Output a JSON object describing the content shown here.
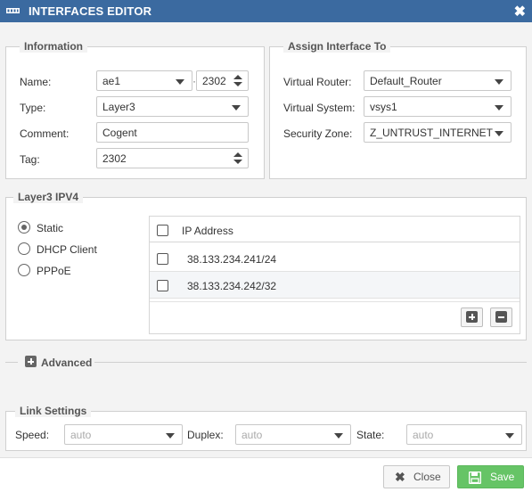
{
  "window": {
    "title": "INTERFACES EDITOR",
    "close_glyph": "✖"
  },
  "information": {
    "legend": "Information",
    "name_label": "Name:",
    "name_value": "ae1",
    "subinterface_value": "2302",
    "type_label": "Type:",
    "type_value": "Layer3",
    "comment_label": "Comment:",
    "comment_value": "Cogent",
    "tag_label": "Tag:",
    "tag_value": "2302"
  },
  "assign": {
    "legend": "Assign Interface To",
    "router_label": "Virtual Router:",
    "router_value": "Default_Router",
    "system_label": "Virtual System:",
    "system_value": "vsys1",
    "zone_label": "Security Zone:",
    "zone_value": "Z_UNTRUST_INTERNET"
  },
  "ipv4": {
    "legend": "Layer3 IPV4",
    "modes": [
      {
        "label": "Static",
        "checked": true
      },
      {
        "label": "DHCP Client",
        "checked": false
      },
      {
        "label": "PPPoE",
        "checked": false
      }
    ],
    "column_header": "IP Address",
    "addresses": [
      "38.133.234.241/24",
      "38.133.234.242/32"
    ]
  },
  "advanced": {
    "label": "Advanced"
  },
  "link": {
    "legend": "Link Settings",
    "speed_label": "Speed:",
    "speed_value": "auto",
    "duplex_label": "Duplex:",
    "duplex_value": "auto",
    "state_label": "State:",
    "state_value": "auto"
  },
  "footer": {
    "close_label": "Close",
    "save_label": "Save"
  },
  "colors": {
    "titlebar": "#3b6aa0",
    "save": "#66c466",
    "panel_bg": "#f3f3f3"
  }
}
